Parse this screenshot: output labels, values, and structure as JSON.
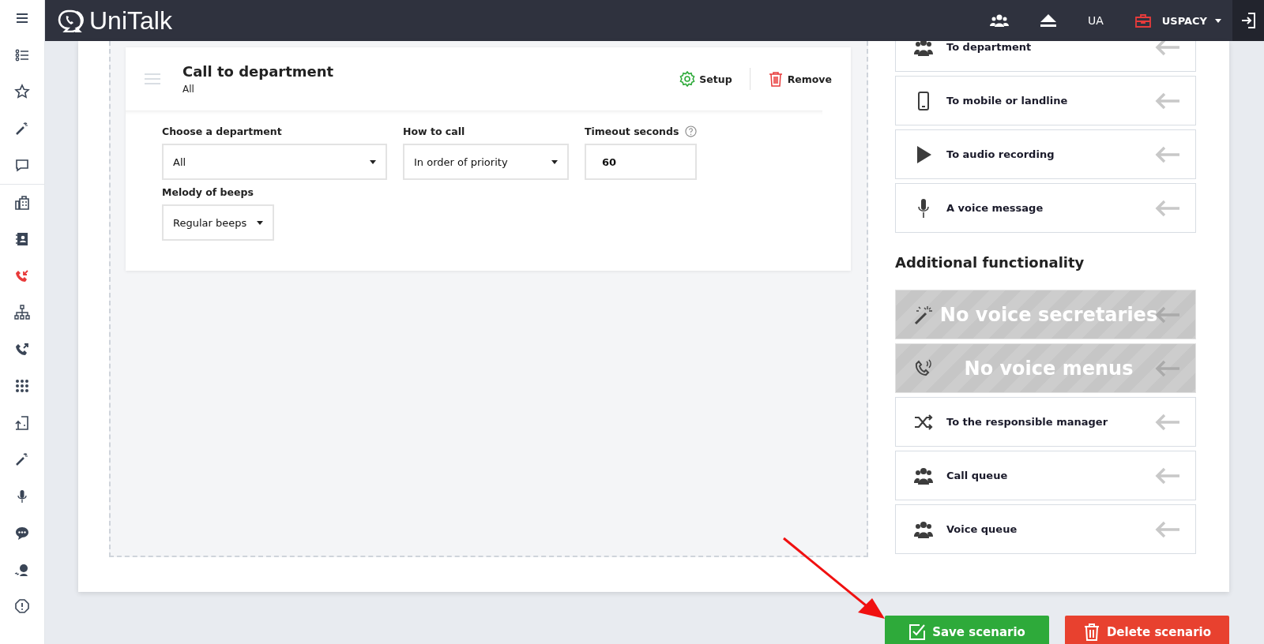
{
  "top_bar": {
    "logo": "UniTalk",
    "language": "UA",
    "company": "USPACY"
  },
  "sidebar": {
    "items": [
      {
        "selected": false
      },
      {
        "selected": false
      },
      {
        "selected": false
      },
      {
        "selected": false
      },
      {
        "selected": false
      },
      {
        "selected": false
      },
      {
        "selected": true
      },
      {
        "selected": false
      },
      {
        "selected": false
      },
      {
        "selected": false
      },
      {
        "selected": false
      },
      {
        "selected": false
      },
      {
        "selected": false
      },
      {
        "selected": false
      },
      {
        "selected": false
      },
      {
        "selected": false
      }
    ]
  },
  "step": {
    "title": "Call to department",
    "subtitle": "All",
    "setup": "Setup",
    "remove": "Remove",
    "fields": [
      {
        "kind": "select",
        "label": "Choose a department",
        "value": "All"
      },
      {
        "kind": "select",
        "label": "How to call",
        "value": "In order of priority"
      },
      {
        "kind": "input",
        "label": "Timeout seconds",
        "value": "60",
        "help": true
      },
      {
        "kind": "select",
        "label": "Melody of beeps",
        "value": "Regular beeps"
      }
    ]
  },
  "actions": [
    {
      "label": "To department",
      "disabled": false
    },
    {
      "label": "To mobile or landline",
      "disabled": false
    },
    {
      "label": "To audio recording",
      "disabled": false
    },
    {
      "label": "A voice message",
      "disabled": false
    }
  ],
  "additional": {
    "title": "Additional functionality",
    "actions": [
      {
        "overlay": "No voice secretaries",
        "disabled": true
      },
      {
        "overlay": "No voice menus",
        "disabled": true
      },
      {
        "label": "To the responsible manager",
        "disabled": false
      },
      {
        "label": "Call queue",
        "disabled": false
      },
      {
        "label": "Voice queue",
        "disabled": false
      }
    ]
  },
  "buttons": {
    "save": "Save scenario",
    "delete": "Delete scenario"
  }
}
